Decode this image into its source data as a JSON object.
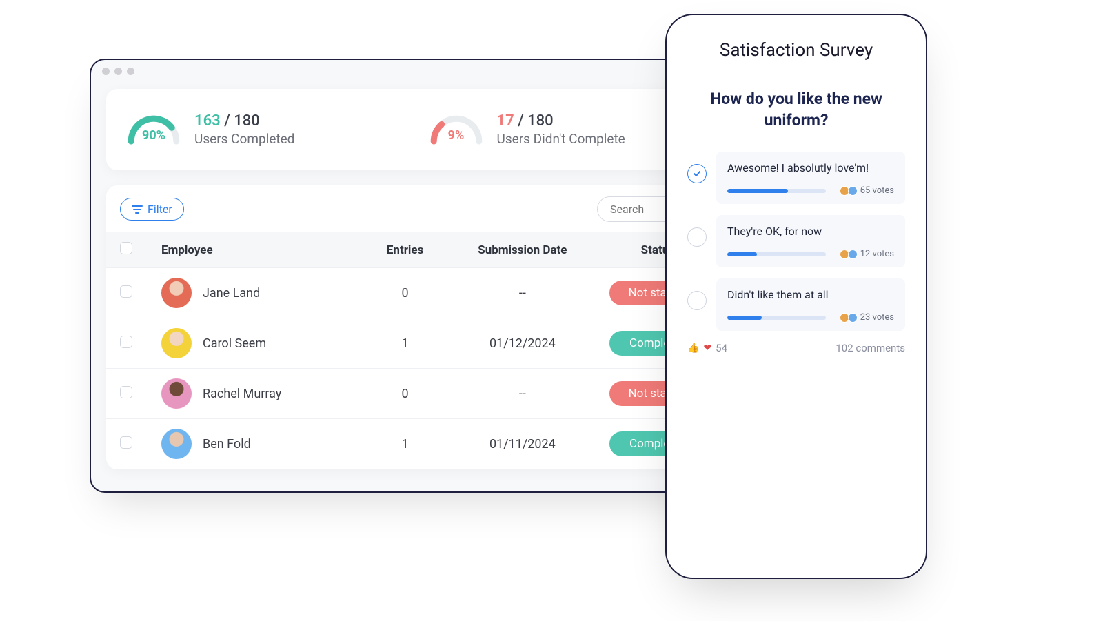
{
  "stats": {
    "completed": {
      "percent": "90%",
      "count": "163",
      "total": "/ 180",
      "label": "Users Completed"
    },
    "not_completed": {
      "percent": "9%",
      "count": "17",
      "total": "/ 180",
      "label": "Users Didn't Complete"
    }
  },
  "toolbar": {
    "filter_label": "Filter",
    "search_placeholder": "Search"
  },
  "table": {
    "headers": {
      "employee": "Employee",
      "entries": "Entries",
      "date": "Submission Date",
      "status": "Status"
    },
    "rows": [
      {
        "name": "Jane Land",
        "entries": "0",
        "date": "--",
        "status": "Not started",
        "status_color": "red",
        "avatar": "av1"
      },
      {
        "name": "Carol Seem",
        "entries": "1",
        "date": "01/12/2024",
        "status": "Completed",
        "status_color": "green",
        "avatar": "av2"
      },
      {
        "name": "Rachel Murray",
        "entries": "0",
        "date": "--",
        "status": "Not started",
        "status_color": "red",
        "avatar": "av3"
      },
      {
        "name": "Ben Fold",
        "entries": "1",
        "date": "01/11/2024",
        "status": "Completed",
        "status_color": "green",
        "avatar": "av4"
      }
    ]
  },
  "phone": {
    "title": "Satisfaction Survey",
    "question": "How do you like the new uniform?",
    "options": [
      {
        "label": "Awesome! I absolutly love'm!",
        "votes": "65 votes",
        "fill": 62,
        "selected": true
      },
      {
        "label": "They're OK, for now",
        "votes": "12 votes",
        "fill": 30,
        "selected": false
      },
      {
        "label": "Didn't like them at all",
        "votes": "23 votes",
        "fill": 35,
        "selected": false
      }
    ],
    "reactions_count": "54",
    "comments": "102 comments"
  }
}
